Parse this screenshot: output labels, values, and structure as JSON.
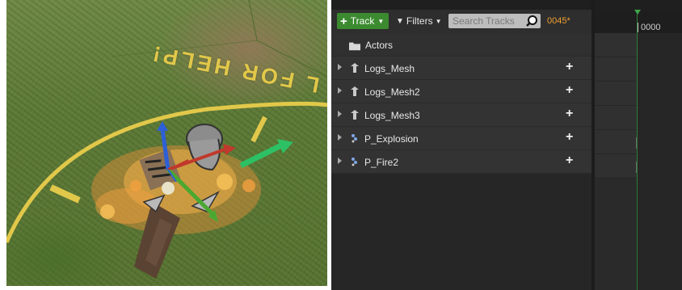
{
  "viewport": {
    "ground_text": "L FOR HELP!"
  },
  "toolbar": {
    "track_label": "Track",
    "filters_label": "Filters",
    "search_placeholder": "Search Tracks",
    "frame_count": "0045*"
  },
  "outliner": {
    "folder_label": "Actors",
    "tracks": [
      {
        "label": "Logs_Mesh",
        "icon": "static-mesh-icon"
      },
      {
        "label": "Logs_Mesh2",
        "icon": "static-mesh-icon"
      },
      {
        "label": "Logs_Mesh3",
        "icon": "static-mesh-icon"
      },
      {
        "label": "P_Explosion",
        "icon": "particle-system-icon"
      },
      {
        "label": "P_Fire2",
        "icon": "particle-system-icon"
      }
    ]
  },
  "timeline": {
    "ruler_label": "0000"
  },
  "colors": {
    "accent_green": "#3b8a2f",
    "frame_orange": "#f0a030",
    "panel_bg": "#262626"
  }
}
